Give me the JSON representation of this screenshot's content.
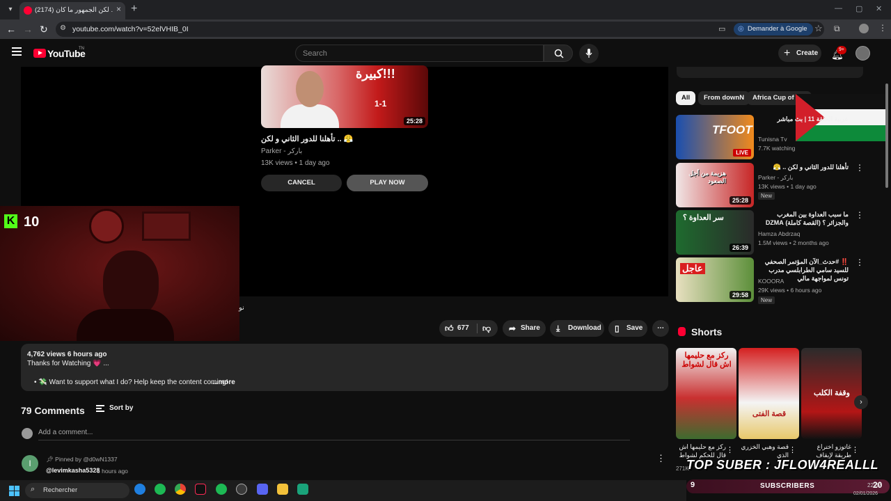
{
  "browser": {
    "tab_title": "(2174) تأهلنا.. لكن الجمهور ما كان",
    "url": "youtube.com/watch?v=52elVHIB_0I",
    "ask_google": "Demander à Google"
  },
  "header": {
    "wordmark": "YouTube",
    "country": "TN",
    "search_placeholder": "Search",
    "create_label": "Create",
    "notifications_badge": "9+"
  },
  "endcard": {
    "thumb_text": "كبيرة!!!",
    "thumb_score": "1-1",
    "duration": "25:28",
    "title": "تأهلنا للدور الثاني و لكن .. 😤",
    "channel": "Parker - باركر",
    "meta": "13K views • 1 day ago",
    "cancel_label": "CANCEL",
    "play_label": "PLAY NOW"
  },
  "overlay": {
    "kick_count": "10",
    "subtitle_fragment": "نو"
  },
  "actions": {
    "likes": "677",
    "share": "Share",
    "download": "Download",
    "save": "Save"
  },
  "description": {
    "stats": "4,762 views  6 hours ago",
    "line1": "Thanks for Watching 💗 ...",
    "line2": "• 💸 Want to support what I do? Help keep the content coming!",
    "more": "...more"
  },
  "comments": {
    "count_label": "79 Comments",
    "sort_label": "Sort by",
    "add_placeholder": "Add a comment...",
    "avatar_letter": "I",
    "pinned_by": "Pinned by @d0wN1337",
    "author": "@levimkasha5328",
    "time": "5 hours ago"
  },
  "sidebar": {
    "chips": [
      "All",
      "From downN",
      "Africa Cup of N..."
    ],
    "recommendations": [
      {
        "title": "عربية الحلقة 11 | بث مباشر",
        "channel": "Tunisna Tv",
        "meta": "7.7K watching",
        "badge": "LIVE",
        "thumb_text": "TFOOT"
      },
      {
        "title": "تأهلنا للدور الثاني و لكن .. 😤",
        "channel": "Parker - باركر",
        "meta": "13K views • 1 day ago",
        "badge": "New",
        "duration": "25:28",
        "thumb_text": "هزيمة من أجل الصعود"
      },
      {
        "title": "ما سبب العداوة بين المغرب والجزائر ؟ (القصة كاملة) DZMA",
        "channel": "Hamza Abdrzaq",
        "meta": "1.5M views • 2 months ago",
        "duration": "26:39",
        "thumb_text": "سر العداوة ؟"
      },
      {
        "title": "‼️ #حدث_الآن المؤتمر الصحفي للسيد سامي الطرابلسي مدرب تونس لمواجهة مالي",
        "channel": "KOOORA",
        "meta": "29K views • 6 hours ago",
        "badge": "New",
        "duration": "29:58",
        "thumb_text": "عاجل"
      }
    ],
    "shorts_title": "Shorts",
    "shorts": [
      {
        "text": "ركز مع حليمها اش قال لشواط",
        "caption": "ركز مع حليمها اش قال للحكم لشواط"
      },
      {
        "text": "قصة الفتى",
        "caption": "قصة وهبي الخزري الذي"
      },
      {
        "text": "وقفة الكلب",
        "caption": "غاتوزو اختراع طريقة لإيقاف"
      }
    ],
    "shorts_views": "271K"
  },
  "stream_overlay": {
    "banner": "TOP SUBER : JFLOW4REALLL",
    "subs_number": "9",
    "subs_label": "SUBSCRIBERS",
    "subs_target": "20"
  },
  "taskbar": {
    "search_label": "Rechercher",
    "time": "22:07",
    "date": "02/01/2026"
  }
}
